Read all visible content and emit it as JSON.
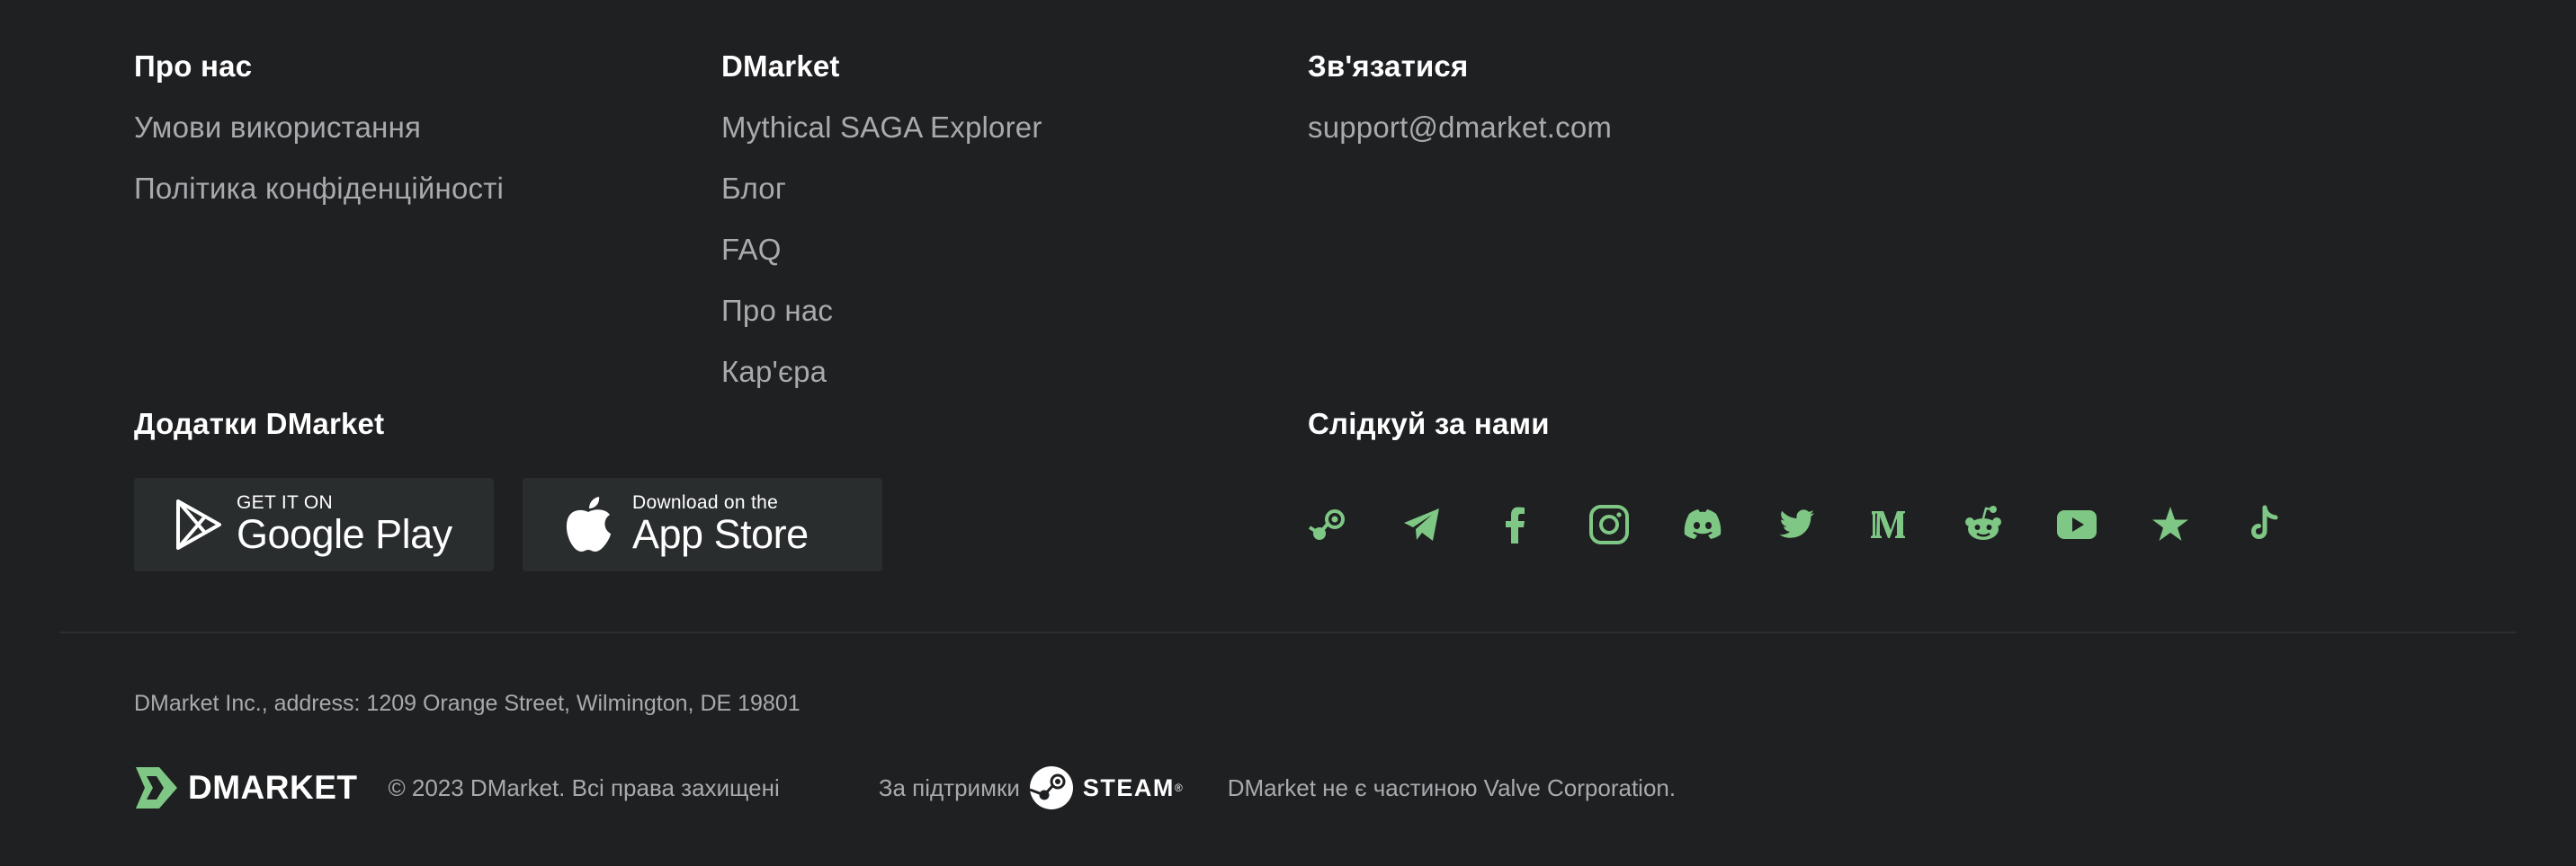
{
  "columns": {
    "about": {
      "title": "Про нас",
      "links": [
        "Умови використання",
        "Політика конфіденційності"
      ]
    },
    "dmarket": {
      "title": "DMarket",
      "links": [
        "Mythical SAGA Explorer",
        "Блог",
        "FAQ",
        "Про нас",
        "Кар'єра"
      ]
    },
    "contact": {
      "title": "Зв'язатися",
      "links": [
        "support@dmarket.com"
      ]
    }
  },
  "apps": {
    "title": "Додатки DMarket",
    "google_play": {
      "small": "GET IT ON",
      "big": "Google Play"
    },
    "app_store": {
      "small": "Download on the",
      "big": "App Store"
    }
  },
  "follow": {
    "title": "Слідкуй за нами",
    "icons": [
      "steam-icon",
      "telegram-icon",
      "facebook-icon",
      "instagram-icon",
      "discord-icon",
      "twitter-icon",
      "medium-icon",
      "reddit-icon",
      "youtube-icon",
      "trustpilot-icon",
      "tiktok-icon"
    ],
    "icon_color": "#7fc784"
  },
  "footer": {
    "address": "DMarket Inc., address: 1209 Orange Street, Wilmington, DE 19801",
    "logo_text": "DMARKET",
    "copyright": "© 2023 DMarket. Всі права захищені",
    "support_label": "За підтримки",
    "steam_text": "STEAM",
    "steam_mark": "®",
    "valve_note": "DMarket не є частиною Valve Corporation."
  },
  "colors": {
    "background": "#1f2022",
    "link": "#a8aaad",
    "accent": "#7fc784",
    "button_bg": "#2a2d2e"
  }
}
